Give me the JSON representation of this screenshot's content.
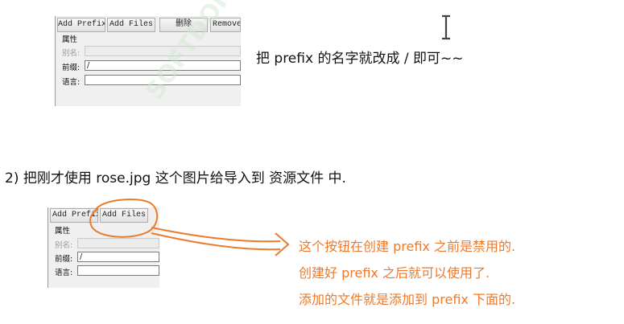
{
  "screenshot_top": {
    "buttons": [
      "Add Prefix",
      "Add Files",
      "删除",
      "Remove"
    ],
    "section_label": "属性",
    "alias_label": "别名:",
    "prefix_label": "前缀:",
    "prefix_value": "/",
    "language_label": "语言:"
  },
  "caption_top": "把 prefix 的名字就改成 / 即可~~",
  "step_text": "2) 把刚才使用 rose.jpg 这个图片给导入到 资源文件 中.",
  "screenshot_bottom": {
    "buttons": [
      "Add Prefix",
      "Add Files"
    ],
    "section_label": "属性",
    "alias_label": "别名:",
    "prefix_label": "前缀:",
    "prefix_value": "/",
    "language_label": "语言:"
  },
  "annotation": {
    "color": "#ec7a2a",
    "lines": [
      "这个按钮在创建 prefix 之前是禁用的.",
      "创建好 prefix 之后就可以使用了.",
      "添加的文件就是添加到 prefix 下面的."
    ]
  },
  "watermark": "SOFTDOKU",
  "icons": [
    "text-cursor-icon"
  ]
}
